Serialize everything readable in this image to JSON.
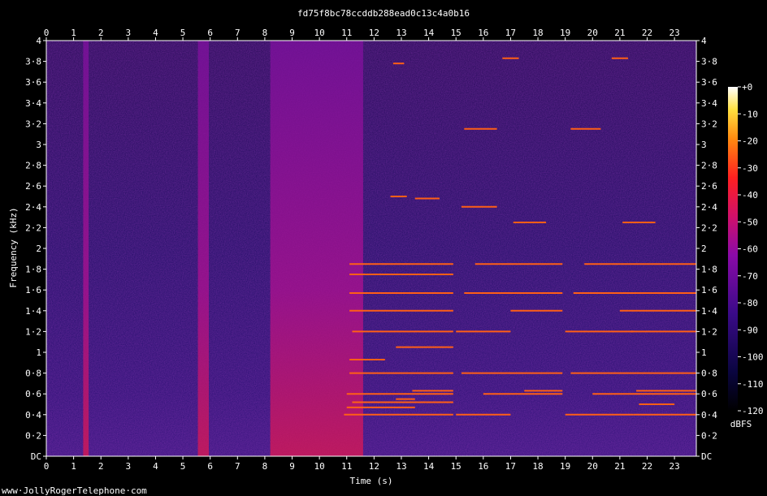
{
  "chart_data": {
    "type": "heatmap",
    "title": "fd75f8bc78ccddb288ead0c13c4a0b16",
    "xlabel": "Time (s)",
    "ylabel": "Frequency (kHz)",
    "xlim": [
      0,
      23.8
    ],
    "ylim": [
      0,
      4
    ],
    "x_ticks": [
      "0",
      "1",
      "2",
      "3",
      "4",
      "5",
      "6",
      "7",
      "8",
      "9",
      "10",
      "11",
      "12",
      "13",
      "14",
      "15",
      "16",
      "17",
      "18",
      "19",
      "20",
      "21",
      "22",
      "23"
    ],
    "y_ticks": [
      {
        "v": 0,
        "t": "DC"
      },
      {
        "v": 0.2,
        "t": "0·2"
      },
      {
        "v": 0.4,
        "t": "0·4"
      },
      {
        "v": 0.6,
        "t": "0·6"
      },
      {
        "v": 0.8,
        "t": "0·8"
      },
      {
        "v": 1.0,
        "t": "1"
      },
      {
        "v": 1.2,
        "t": "1·2"
      },
      {
        "v": 1.4,
        "t": "1·4"
      },
      {
        "v": 1.6,
        "t": "1·6"
      },
      {
        "v": 1.8,
        "t": "1·8"
      },
      {
        "v": 2.0,
        "t": "2"
      },
      {
        "v": 2.2,
        "t": "2·2"
      },
      {
        "v": 2.4,
        "t": "2·4"
      },
      {
        "v": 2.6,
        "t": "2·6"
      },
      {
        "v": 2.8,
        "t": "2·8"
      },
      {
        "v": 3.0,
        "t": "3"
      },
      {
        "v": 3.2,
        "t": "3·2"
      },
      {
        "v": 3.4,
        "t": "3·4"
      },
      {
        "v": 3.6,
        "t": "3·6"
      },
      {
        "v": 3.8,
        "t": "3·8"
      },
      {
        "v": 4.0,
        "t": "4"
      }
    ],
    "colorbar": {
      "label": "dBFS",
      "ticks": [
        "+0",
        "-10",
        "-20",
        "-30",
        "-40",
        "-50",
        "-60",
        "-70",
        "-80",
        "-90",
        "-100",
        "-110",
        "-120"
      ],
      "range": [
        -120,
        0
      ]
    },
    "bursts": [
      {
        "t0": 1.35,
        "t1": 1.55,
        "level": -20
      },
      {
        "t0": 5.55,
        "t1": 5.95,
        "level": -45
      },
      {
        "t0": 8.2,
        "t1": 11.6,
        "level": -30
      }
    ],
    "tones": [
      {
        "t0": 10.9,
        "t1": 14.9,
        "f": 0.4
      },
      {
        "t0": 11.0,
        "t1": 13.5,
        "f": 0.47
      },
      {
        "t0": 11.2,
        "t1": 14.9,
        "f": 0.52
      },
      {
        "t0": 12.8,
        "t1": 13.5,
        "f": 0.55
      },
      {
        "t0": 11.0,
        "t1": 14.9,
        "f": 0.6
      },
      {
        "t0": 13.4,
        "t1": 14.9,
        "f": 0.63
      },
      {
        "t0": 11.1,
        "t1": 14.9,
        "f": 0.8
      },
      {
        "t0": 11.1,
        "t1": 12.4,
        "f": 0.93
      },
      {
        "t0": 12.8,
        "t1": 14.9,
        "f": 1.05
      },
      {
        "t0": 11.2,
        "t1": 14.9,
        "f": 1.2
      },
      {
        "t0": 11.1,
        "t1": 14.9,
        "f": 1.4
      },
      {
        "t0": 11.1,
        "t1": 14.9,
        "f": 1.57
      },
      {
        "t0": 11.1,
        "t1": 14.9,
        "f": 1.75
      },
      {
        "t0": 11.1,
        "t1": 14.9,
        "f": 1.85
      },
      {
        "t0": 12.6,
        "t1": 13.2,
        "f": 2.5
      },
      {
        "t0": 13.5,
        "t1": 14.4,
        "f": 2.48
      },
      {
        "t0": 12.7,
        "t1": 13.1,
        "f": 3.78
      },
      {
        "t0": 15.0,
        "t1": 17.0,
        "f": 0.4
      },
      {
        "t0": 16.0,
        "t1": 18.9,
        "f": 0.6
      },
      {
        "t0": 15.2,
        "t1": 18.9,
        "f": 0.8
      },
      {
        "t0": 15.0,
        "t1": 17.0,
        "f": 1.2
      },
      {
        "t0": 15.3,
        "t1": 18.9,
        "f": 1.57
      },
      {
        "t0": 15.7,
        "t1": 18.9,
        "f": 1.85
      },
      {
        "t0": 15.3,
        "t1": 16.5,
        "f": 3.15
      },
      {
        "t0": 17.1,
        "t1": 18.3,
        "f": 2.25
      },
      {
        "t0": 15.2,
        "t1": 16.5,
        "f": 2.4
      },
      {
        "t0": 17.5,
        "t1": 18.9,
        "f": 0.63
      },
      {
        "t0": 17.0,
        "t1": 18.9,
        "f": 1.4
      },
      {
        "t0": 16.7,
        "t1": 17.3,
        "f": 3.83
      },
      {
        "t0": 19.0,
        "t1": 21.5,
        "f": 0.4
      },
      {
        "t0": 20.0,
        "t1": 23.8,
        "f": 0.6
      },
      {
        "t0": 19.2,
        "t1": 23.8,
        "f": 0.8
      },
      {
        "t0": 19.0,
        "t1": 21.5,
        "f": 1.2
      },
      {
        "t0": 19.3,
        "t1": 23.8,
        "f": 1.57
      },
      {
        "t0": 19.7,
        "t1": 23.8,
        "f": 1.85
      },
      {
        "t0": 19.2,
        "t1": 20.3,
        "f": 3.15
      },
      {
        "t0": 21.1,
        "t1": 22.3,
        "f": 2.25
      },
      {
        "t0": 21.6,
        "t1": 23.8,
        "f": 0.63
      },
      {
        "t0": 21.4,
        "t1": 23.8,
        "f": 1.2
      },
      {
        "t0": 21.0,
        "t1": 23.8,
        "f": 1.4
      },
      {
        "t0": 20.7,
        "t1": 21.3,
        "f": 3.83
      },
      {
        "t0": 21.5,
        "t1": 23.8,
        "f": 0.4
      },
      {
        "t0": 21.7,
        "t1": 23.0,
        "f": 0.5
      }
    ]
  },
  "watermark": "www·JollyRogerTelephone·com"
}
